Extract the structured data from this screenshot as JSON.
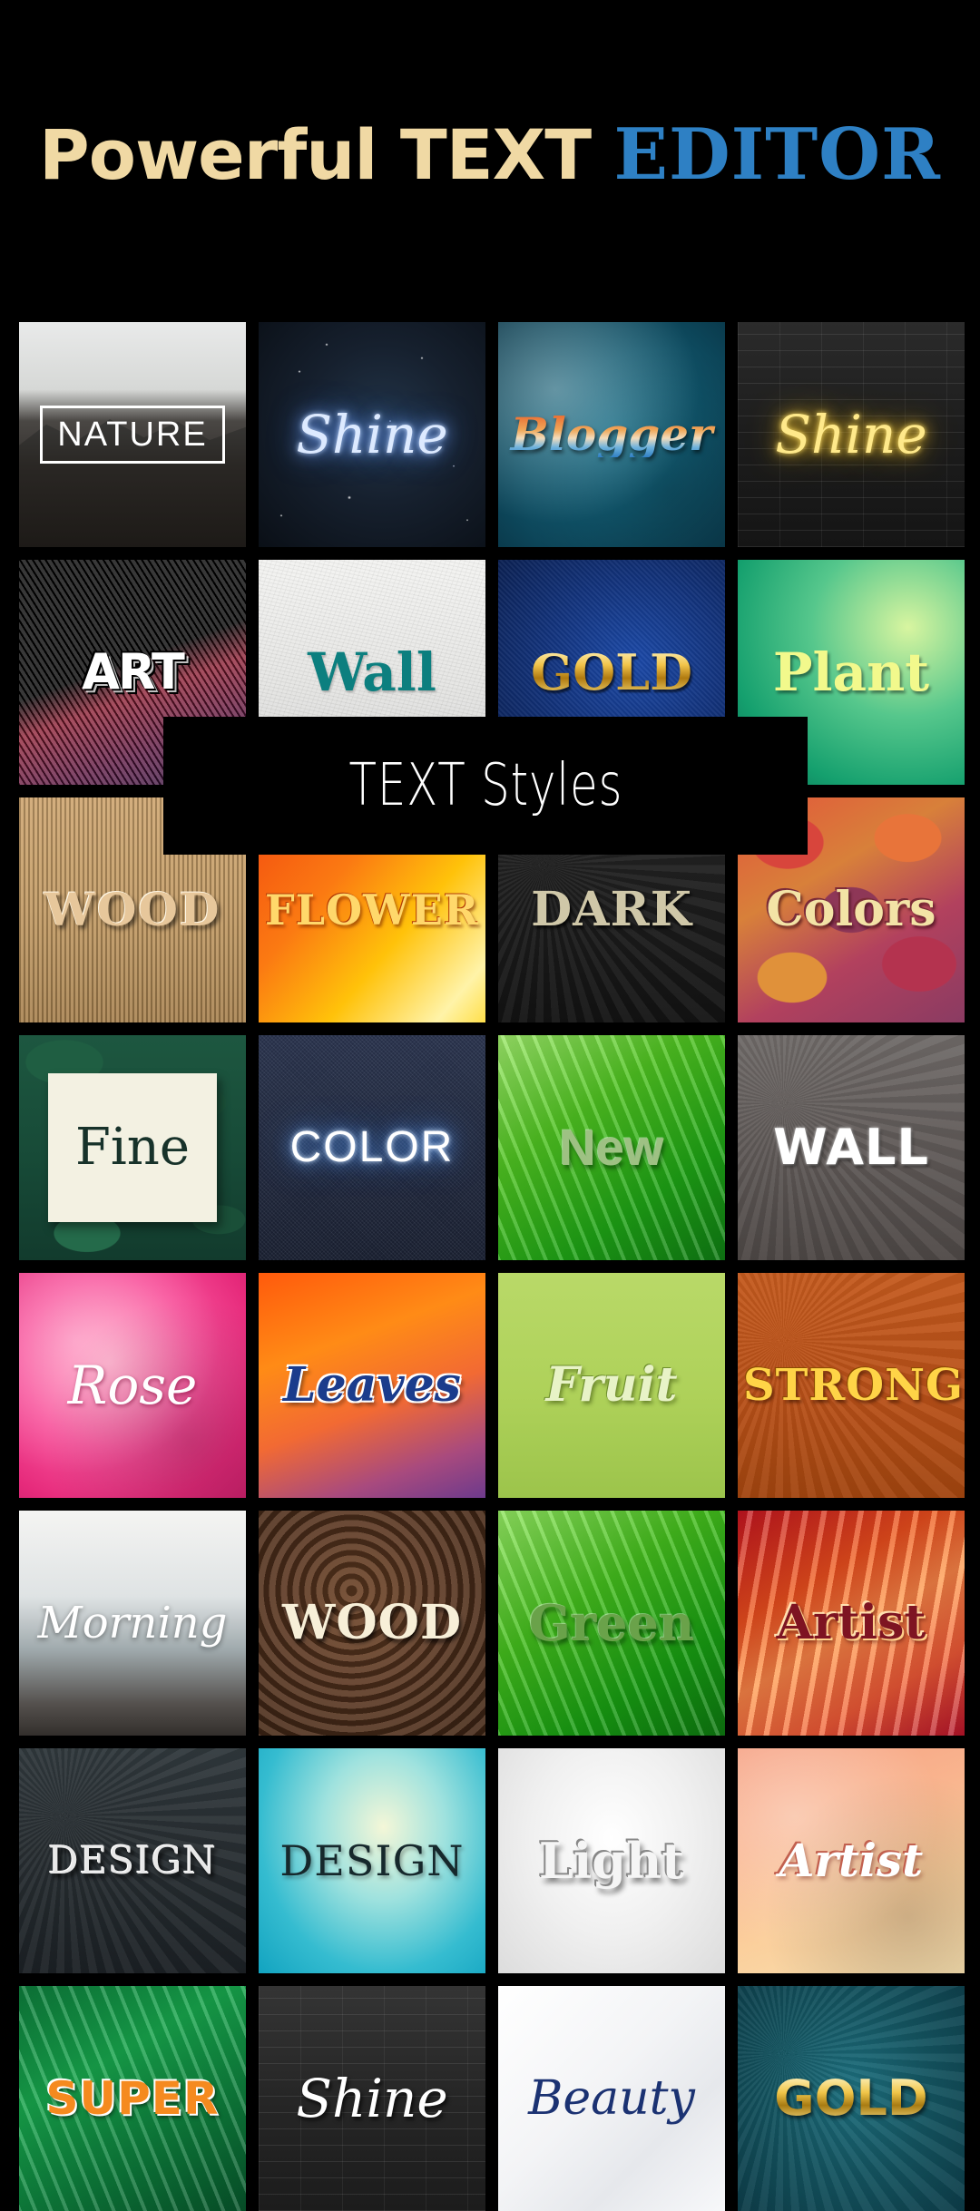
{
  "header": {
    "title_part1": "Powerful ",
    "title_part2": "TEXT ",
    "title_part3": "EDITOR",
    "colors": {
      "cream": "#f0d9a4",
      "blue": "#2e80c4",
      "background": "#000000"
    }
  },
  "overlay_banner": {
    "label": "TEXT Styles",
    "text_color": "#ffffff",
    "background": "#000000"
  },
  "gallery": {
    "columns": 4,
    "tiles": [
      {
        "label": "NATURE",
        "style": "nature"
      },
      {
        "label": "Shine",
        "style": "shine-neon"
      },
      {
        "label": "Blogger",
        "style": "blogger"
      },
      {
        "label": "Shine",
        "style": "shine-brick"
      },
      {
        "label": "ART",
        "style": "art"
      },
      {
        "label": "Wall",
        "style": "wall"
      },
      {
        "label": "GOLD",
        "style": "gold-blue"
      },
      {
        "label": "Plant",
        "style": "plant"
      },
      {
        "label": "WOOD",
        "style": "wood-slats"
      },
      {
        "label": "FLOWER",
        "style": "flower"
      },
      {
        "label": "DARK",
        "style": "dark"
      },
      {
        "label": "Colors",
        "style": "colors"
      },
      {
        "label": "Fine",
        "style": "fine"
      },
      {
        "label": "COLOR",
        "style": "color-neon"
      },
      {
        "label": "New",
        "style": "new-green"
      },
      {
        "label": "WALL",
        "style": "wall-chalk"
      },
      {
        "label": "Rose",
        "style": "rose"
      },
      {
        "label": "Leaves",
        "style": "leaves"
      },
      {
        "label": "Fruit",
        "style": "fruit"
      },
      {
        "label": "STRONG",
        "style": "strong"
      },
      {
        "label": "Morning",
        "style": "morning"
      },
      {
        "label": "WOOD",
        "style": "wood-grain"
      },
      {
        "label": "Green",
        "style": "green"
      },
      {
        "label": "Artist",
        "style": "artist-red"
      },
      {
        "label": "DESIGN",
        "style": "design-dark"
      },
      {
        "label": "DESIGN",
        "style": "design-teal"
      },
      {
        "label": "Light",
        "style": "light"
      },
      {
        "label": "Artist",
        "style": "artist-peach"
      },
      {
        "label": "SUPER",
        "style": "super"
      },
      {
        "label": "Shine",
        "style": "shine-script"
      },
      {
        "label": "Beauty",
        "style": "beauty"
      },
      {
        "label": "GOLD",
        "style": "gold-teal"
      }
    ]
  }
}
